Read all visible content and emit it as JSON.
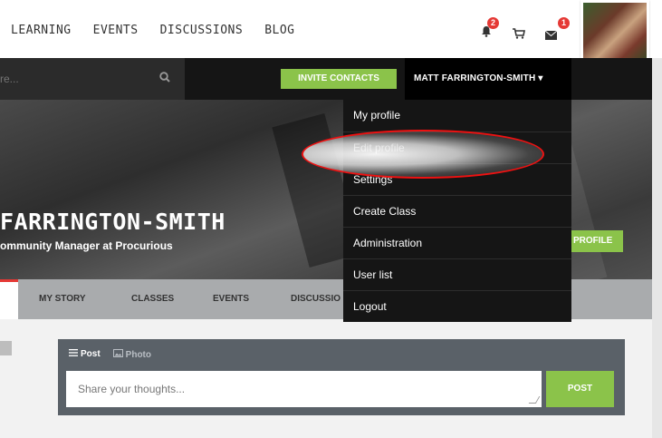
{
  "topnav": {
    "items": [
      "LEARNING",
      "EVENTS",
      "DISCUSSIONS",
      "BLOG"
    ]
  },
  "notifications": {
    "bell_count": "2",
    "mail_count": "1"
  },
  "search": {
    "placeholder": "re..."
  },
  "toolbar": {
    "invite_label": "INVITE CONTACTS",
    "user_label": "MATT FARRINGTON-SMITH ▾"
  },
  "profile": {
    "name": "FARRINGTON-SMITH",
    "role": "ommunity Manager at Procurious",
    "action_label": "PROFILE"
  },
  "profile_tabs": [
    "MY STORY",
    "CLASSES",
    "EVENTS",
    "DISCUSSIO"
  ],
  "user_dropdown": {
    "items": [
      "My profile",
      "Edit profile",
      "Settings",
      "Create Class",
      "Administration",
      "User list",
      "Logout"
    ]
  },
  "composer": {
    "tab_post": "Post",
    "tab_photo": "Photo",
    "placeholder": "Share your thoughts...",
    "submit_label": "POST"
  },
  "colors": {
    "accent_green": "#8bc34a",
    "badge_red": "#e53935",
    "highlight_red": "#e11111"
  }
}
